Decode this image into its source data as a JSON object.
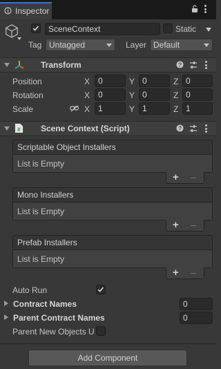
{
  "tab": {
    "title": "Inspector"
  },
  "object": {
    "name": "SceneContext",
    "static_label": "Static",
    "tag_label": "Tag",
    "tag_value": "Untagged",
    "layer_label": "Layer",
    "layer_value": "Default"
  },
  "transform": {
    "title": "Transform",
    "rows": [
      {
        "label": "Position",
        "x": "0",
        "y": "0",
        "z": "0"
      },
      {
        "label": "Rotation",
        "x": "0",
        "y": "0",
        "z": "0"
      },
      {
        "label": "Scale",
        "x": "1",
        "y": "1",
        "z": "1"
      }
    ],
    "axis_x": "X",
    "axis_y": "Y",
    "axis_z": "Z"
  },
  "script": {
    "title": "Scene Context (Script)",
    "lists": [
      {
        "header": "Scriptable Object Installers",
        "body": "List is Empty"
      },
      {
        "header": "Mono Installers",
        "body": "List is Empty"
      },
      {
        "header": "Prefab Installers",
        "body": "List is Empty"
      }
    ],
    "plus": "+",
    "minus": "–",
    "auto_run_label": "Auto Run",
    "contract_names_label": "Contract Names",
    "contract_names_value": "0",
    "parent_contract_names_label": "Parent Contract Names",
    "parent_contract_names_value": "0",
    "parent_new_objects_label": "Parent New Objects U"
  },
  "add_component": "Add Component"
}
